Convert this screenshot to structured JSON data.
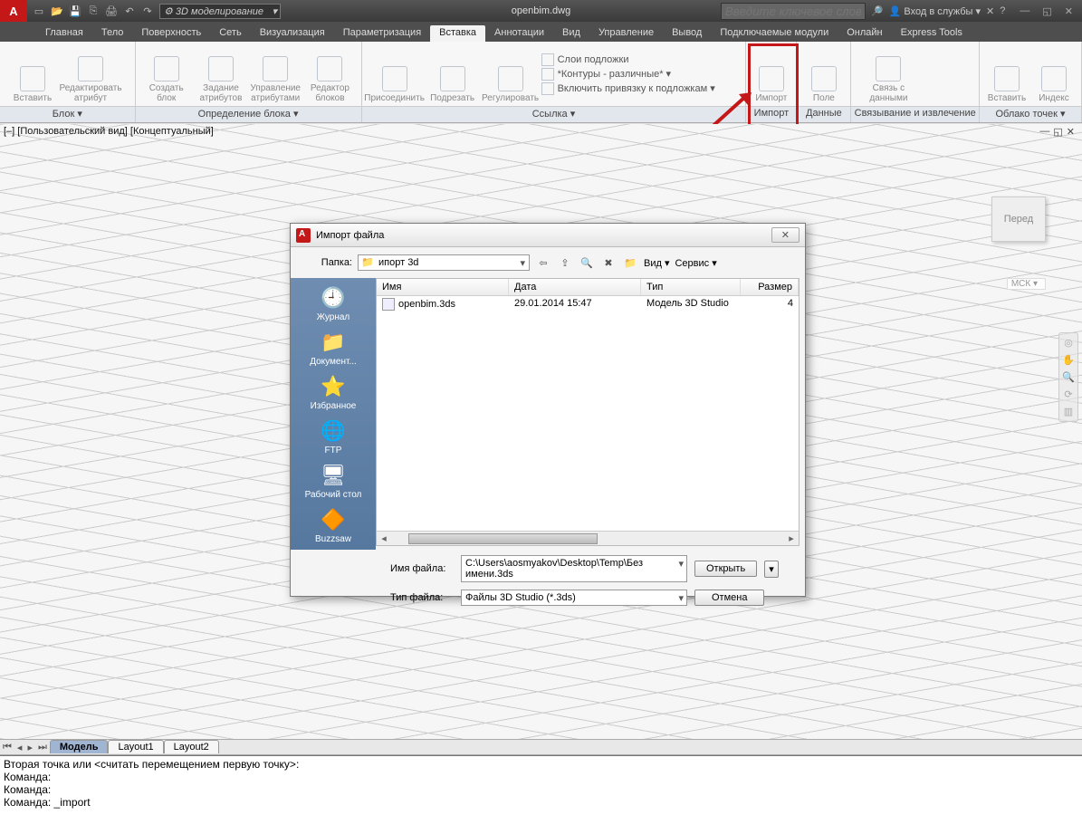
{
  "title": "openbim.dwg",
  "workspace": "3D моделирование",
  "search_placeholder": "Введите ключевое слово/фразу",
  "signin": "Вход в службы",
  "tabs": [
    "Главная",
    "Тело",
    "Поверхность",
    "Сеть",
    "Визуализация",
    "Параметризация",
    "Вставка",
    "Аннотации",
    "Вид",
    "Управление",
    "Вывод",
    "Подключаемые модули",
    "Онлайн",
    "Express Tools"
  ],
  "active_tab": "Вставка",
  "ribbon": {
    "panels": [
      {
        "title": "Блок ▾",
        "items": [
          "Вставить",
          "Редактировать атрибут"
        ]
      },
      {
        "title": "Определение блока ▾",
        "items": [
          "Создать блок",
          "Задание атрибутов",
          "Управление атрибутами",
          "Редактор блоков"
        ]
      },
      {
        "title": "Ссылка ▾",
        "items": [
          "Присоединить",
          "Подрезать",
          "Регулировать"
        ],
        "small": [
          "Слои подложки",
          "*Контуры - различные* ▾",
          "Включить привязку к подложкам ▾"
        ]
      },
      {
        "title": "Импорт",
        "items": [
          "Импорт"
        ]
      },
      {
        "title": "Данные",
        "items": [
          "Поле"
        ]
      },
      {
        "title": "Связывание и извлечение",
        "items": [
          "Связь с данными"
        ]
      },
      {
        "title": "Облако точек ▾",
        "items": [
          "Вставить",
          "Индекс"
        ]
      }
    ]
  },
  "viewport": {
    "label1": "[–] [Пользовательский вид] [Концептуальный]",
    "cube": "Перед",
    "wcs": "МСК ▾"
  },
  "dialog": {
    "title": "Импорт файла",
    "folder_label": "Папка:",
    "folder": "ипорт 3d",
    "view": "Вид",
    "tools": "Сервис",
    "columns": {
      "name": "Имя",
      "date": "Дата",
      "type": "Тип",
      "size": "Размер"
    },
    "row": {
      "name": "openbim.3ds",
      "date": "29.01.2014 15:47",
      "type": "Модель 3D Studio",
      "size": "4"
    },
    "places": [
      "Журнал",
      "Документ...",
      "Избранное",
      "FTP",
      "Рабочий стол",
      "Buzzsaw"
    ],
    "fname_lbl": "Имя файла:",
    "ftype_lbl": "Тип файла:",
    "fname": "C:\\Users\\aosmyakov\\Desktop\\Temp\\Без имени.3ds",
    "ftype": "Файлы 3D Studio (*.3ds)",
    "open": "Открыть",
    "cancel": "Отмена"
  },
  "layouts": {
    "active": "Модель",
    "others": [
      "Layout1",
      "Layout2"
    ]
  },
  "cmd": {
    "l1": "Вторая точка или <считать перемещением первую точку>:",
    "l2": "Команда:",
    "l3": "Команда:",
    "l4": "Команда: _import"
  }
}
